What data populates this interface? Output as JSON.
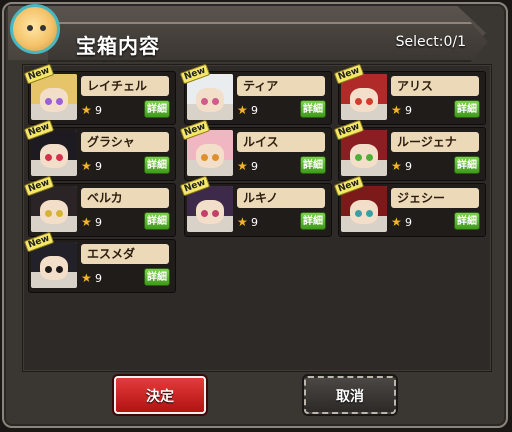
{
  "dialog": {
    "title": "宝箱内容",
    "select_count": "Select:0/1",
    "confirm_label": "決定",
    "cancel_label": "取消"
  },
  "characters": [
    {
      "name": "レイチェル",
      "rank": "9",
      "detail": "詳細",
      "badge": "New",
      "hair": "#e6c56a",
      "eye": "#9b5fd6"
    },
    {
      "name": "ティア",
      "rank": "9",
      "detail": "詳細",
      "badge": "New",
      "hair": "#e9edf0",
      "eye": "#d25a8c"
    },
    {
      "name": "アリス",
      "rank": "9",
      "detail": "詳細",
      "badge": "New",
      "hair": "#b02a2a",
      "eye": "#d33c2c"
    },
    {
      "name": "グラシャ",
      "rank": "9",
      "detail": "詳細",
      "badge": "New",
      "hair": "#1d1a22",
      "eye": "#d2324a"
    },
    {
      "name": "ルイス",
      "rank": "9",
      "detail": "詳細",
      "badge": "New",
      "hair": "#f0b7c3",
      "eye": "#e0902a"
    },
    {
      "name": "ルージェナ",
      "rank": "9",
      "detail": "詳細",
      "badge": "New",
      "hair": "#8b1e22",
      "eye": "#4fae37"
    },
    {
      "name": "ベルカ",
      "rank": "9",
      "detail": "詳細",
      "badge": "New",
      "hair": "#2a2426",
      "eye": "#d6b335"
    },
    {
      "name": "ルキノ",
      "rank": "9",
      "detail": "詳細",
      "badge": "New",
      "hair": "#3d2a4a",
      "eye": "#c63f6b"
    },
    {
      "name": "ジェシー",
      "rank": "9",
      "detail": "詳細",
      "badge": "New",
      "hair": "#7c1a1a",
      "eye": "#3aa0a6"
    },
    {
      "name": "エスメダ",
      "rank": "9",
      "detail": "詳細",
      "badge": "New",
      "hair": "#222028",
      "eye": "#1e1a1a"
    }
  ],
  "icons": {
    "star": "★",
    "mascot": "mascot-icon"
  },
  "colors": {
    "confirm": "#d62525",
    "detail": "#5cb832",
    "name_plate": "#ecd9b8"
  }
}
